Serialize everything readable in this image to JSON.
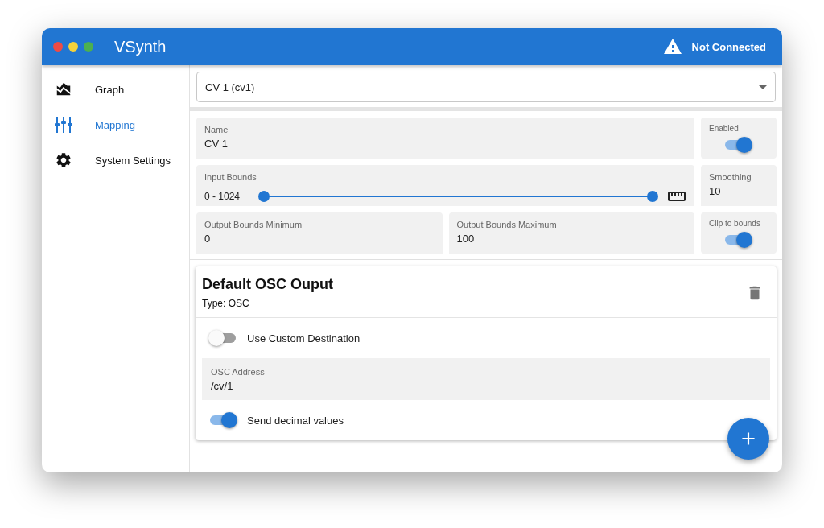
{
  "window": {
    "title": "VSynth"
  },
  "status": {
    "text": "Not Connected"
  },
  "sidebar": {
    "items": [
      {
        "kind": "graph",
        "label": "Graph",
        "selected": false
      },
      {
        "kind": "mapping",
        "label": "Mapping",
        "selected": true
      },
      {
        "kind": "settings",
        "label": "System Settings",
        "selected": false
      }
    ]
  },
  "channel_select": {
    "value": "CV 1 (cv1)"
  },
  "settings": {
    "name": {
      "label": "Name",
      "value": "CV 1"
    },
    "enabled": {
      "label": "Enabled",
      "on": true
    },
    "input_bounds": {
      "label": "Input Bounds",
      "reading": "0 - 1024",
      "thumbs": [
        {
          "level": 0
        },
        {
          "level": 1
        }
      ]
    },
    "smoothing": {
      "label": "Smoothing",
      "value": "10"
    },
    "output_min": {
      "label": "Output Bounds Minimum",
      "value": "0"
    },
    "output_max": {
      "label": "Output Bounds Maximum",
      "value": "100"
    },
    "clip": {
      "label": "Clip to bounds",
      "on": true
    }
  },
  "output": {
    "title": "Default OSC Ouput",
    "type": "Type: OSC",
    "custom_destination": {
      "label": "Use Custom Destination",
      "on": false
    },
    "osc_address": {
      "label": "OSC Address",
      "value": "/cv/1"
    },
    "send_decimal": {
      "label": "Send decimal values",
      "on": true
    }
  }
}
